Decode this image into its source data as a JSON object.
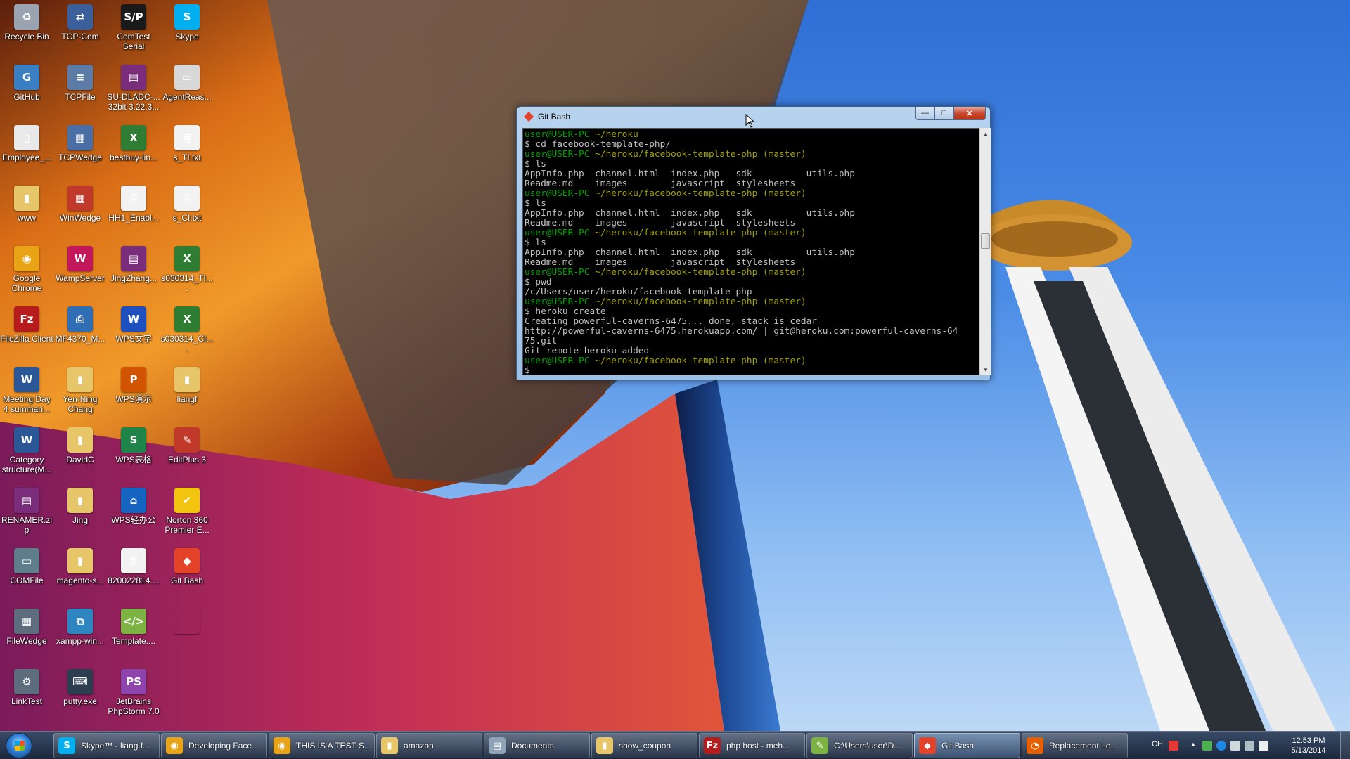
{
  "desktop": {
    "icons": [
      {
        "label": "Recycle Bin",
        "icon": "recycle-bin-icon",
        "color": "#9aa4b0",
        "glyph": "♻"
      },
      {
        "label": "TCP-Com",
        "icon": "tcp-com-icon",
        "color": "#3b5f9a",
        "glyph": "⇄"
      },
      {
        "label": "ComTest Serial",
        "icon": "comtest-serial-icon",
        "color": "#1a1a1a",
        "glyph": "S/P"
      },
      {
        "label": "Skype",
        "icon": "skype-icon",
        "color": "#00aff0",
        "glyph": "S"
      },
      {
        "label": "GitHub",
        "icon": "github-icon",
        "color": "#3a7fc1",
        "glyph": "G"
      },
      {
        "label": "TCPFile",
        "icon": "tcpfile-icon",
        "color": "#5c7ca6",
        "glyph": "≡"
      },
      {
        "label": "SU-DLADC-... 32bit 3.22.3...",
        "icon": "winrar-archive-icon",
        "color": "#7a2d7a",
        "glyph": "▤"
      },
      {
        "label": "AgentReas...",
        "icon": "agentreas-icon",
        "color": "#d8d8d8",
        "glyph": "▭"
      },
      {
        "label": "Employee_...",
        "icon": "document-icon",
        "color": "#e9e9e9",
        "glyph": "▯"
      },
      {
        "label": "TCPWedge",
        "icon": "tcpwedge-icon",
        "color": "#4b6fa5",
        "glyph": "▦"
      },
      {
        "label": "bestbuy-lin...",
        "icon": "excel-file-icon",
        "color": "#2e7d32",
        "glyph": "X"
      },
      {
        "label": "s_TI.txt",
        "icon": "text-file-icon",
        "color": "#f2f2f2",
        "glyph": "≣"
      },
      {
        "label": "www",
        "icon": "folder-icon",
        "color": "#e7c66a",
        "glyph": "▮"
      },
      {
        "label": "WinWedge",
        "icon": "winwedge-icon",
        "color": "#c0392b",
        "glyph": "▦"
      },
      {
        "label": "HH1_Enabl...",
        "icon": "document-icon",
        "color": "#f2f2f2",
        "glyph": "≣"
      },
      {
        "label": "s_CI.txt",
        "icon": "text-file-icon",
        "color": "#f2f2f2",
        "glyph": "≣"
      },
      {
        "label": "Google Chrome",
        "icon": "chrome-icon",
        "color": "#e8a317",
        "glyph": "◉"
      },
      {
        "label": "WampServer",
        "icon": "wampserver-icon",
        "color": "#c2185b",
        "glyph": "W"
      },
      {
        "label": "JingZhang...",
        "icon": "winrar-archive-icon",
        "color": "#7a2d7a",
        "glyph": "▤"
      },
      {
        "label": "s030314_TI....",
        "icon": "excel-file-icon",
        "color": "#2e7d32",
        "glyph": "X"
      },
      {
        "label": "FileZilla Client",
        "icon": "filezilla-icon",
        "color": "#b71c1c",
        "glyph": "Fz"
      },
      {
        "label": "MF4370_M...",
        "icon": "printer-installer-icon",
        "color": "#2f6eb5",
        "glyph": "⎙"
      },
      {
        "label": "WPS文字",
        "icon": "wps-writer-icon",
        "color": "#1e4fbf",
        "glyph": "W"
      },
      {
        "label": "s030314_CI....",
        "icon": "excel-file-icon",
        "color": "#2e7d32",
        "glyph": "X"
      },
      {
        "label": "Meeting Day 4 summari...",
        "icon": "word-file-icon",
        "color": "#2b5797",
        "glyph": "W"
      },
      {
        "label": "Yen-Ning Chang",
        "icon": "folder-icon",
        "color": "#e7c66a",
        "glyph": "▮"
      },
      {
        "label": "WPS演示",
        "icon": "wps-presentation-icon",
        "color": "#d35400",
        "glyph": "P"
      },
      {
        "label": "liangf",
        "icon": "folder-icon",
        "color": "#e7c66a",
        "glyph": "▮"
      },
      {
        "label": "Category structure(M...",
        "icon": "word-file-icon",
        "color": "#2b5797",
        "glyph": "W"
      },
      {
        "label": "DavidC",
        "icon": "folder-icon",
        "color": "#e7c66a",
        "glyph": "▮"
      },
      {
        "label": "WPS表格",
        "icon": "wps-spreadsheet-icon",
        "color": "#1e8449",
        "glyph": "S"
      },
      {
        "label": "EditPlus 3",
        "icon": "editplus-icon",
        "color": "#c0392b",
        "glyph": "✎"
      },
      {
        "label": "RENAMER.zip",
        "icon": "winrar-archive-icon",
        "color": "#7a2d7a",
        "glyph": "▤"
      },
      {
        "label": "Jing",
        "icon": "folder-icon",
        "color": "#e7c66a",
        "glyph": "▮"
      },
      {
        "label": "WPS轻办公",
        "icon": "wps-office-icon",
        "color": "#1565c0",
        "glyph": "⌂"
      },
      {
        "label": "Norton 360 Premier E...",
        "icon": "norton-icon",
        "color": "#f1c40f",
        "glyph": "✔"
      },
      {
        "label": "COMFile",
        "icon": "comfile-icon",
        "color": "#607d8b",
        "glyph": "▭"
      },
      {
        "label": "magento-s...",
        "icon": "folder-icon",
        "color": "#e7c66a",
        "glyph": "▮"
      },
      {
        "label": "820022814....",
        "icon": "document-icon",
        "color": "#f2f2f2",
        "glyph": "≣"
      },
      {
        "label": "Git Bash",
        "icon": "git-bash-icon",
        "color": "#e24329",
        "glyph": "◆"
      },
      {
        "label": "FileWedge",
        "icon": "filewedge-icon",
        "color": "#5d6d7e",
        "glyph": "▦"
      },
      {
        "label": "xampp-win...",
        "icon": "xampp-installer-icon",
        "color": "#2e86c1",
        "glyph": "⧉"
      },
      {
        "label": "Template....",
        "icon": "html-file-icon",
        "color": "#7cb342",
        "glyph": "</>"
      },
      {
        "label": "",
        "icon": "blank-icon",
        "color": "transparent",
        "glyph": ""
      },
      {
        "label": "LinkTest",
        "icon": "linktest-icon",
        "color": "#5d6d7e",
        "glyph": "⚙"
      },
      {
        "label": "putty.exe",
        "icon": "putty-icon",
        "color": "#2c3e50",
        "glyph": "⌨"
      },
      {
        "label": "JetBrains PhpStorm 7.0",
        "icon": "phpstorm-icon",
        "color": "#8e44ad",
        "glyph": "PS"
      }
    ]
  },
  "window": {
    "title": "Git Bash",
    "buttons": {
      "minimize": "—",
      "maximize": "□",
      "close": "✕"
    },
    "terminal": [
      [
        {
          "t": "user@USER-PC",
          "c": "green"
        },
        {
          "t": " ~/heroku",
          "c": "yellow"
        }
      ],
      [
        {
          "t": "$ cd facebook-template-php/",
          "c": "white"
        }
      ],
      [
        {
          "t": "user@USER-PC",
          "c": "green"
        },
        {
          "t": " ~/heroku/facebook-template-php (master)",
          "c": "yellow"
        }
      ],
      [
        {
          "t": "$ ls",
          "c": "white"
        }
      ],
      [
        {
          "t": "AppInfo.php  channel.html  index.php   sdk          utils.php",
          "c": "white"
        }
      ],
      [
        {
          "t": "Readme.md    images        javascript  stylesheets",
          "c": "white"
        }
      ],
      [
        {
          "t": "user@USER-PC",
          "c": "green"
        },
        {
          "t": " ~/heroku/facebook-template-php (master)",
          "c": "yellow"
        }
      ],
      [
        {
          "t": "$ ls",
          "c": "white"
        }
      ],
      [
        {
          "t": "AppInfo.php  channel.html  index.php   sdk          utils.php",
          "c": "white"
        }
      ],
      [
        {
          "t": "Readme.md    images        javascript  stylesheets",
          "c": "white"
        }
      ],
      [
        {
          "t": "user@USER-PC",
          "c": "green"
        },
        {
          "t": " ~/heroku/facebook-template-php (master)",
          "c": "yellow"
        }
      ],
      [
        {
          "t": "$ ls",
          "c": "white"
        }
      ],
      [
        {
          "t": "AppInfo.php  channel.html  index.php   sdk          utils.php",
          "c": "white"
        }
      ],
      [
        {
          "t": "Readme.md    images        javascript  stylesheets",
          "c": "white"
        }
      ],
      [
        {
          "t": "user@USER-PC",
          "c": "green"
        },
        {
          "t": " ~/heroku/facebook-template-php (master)",
          "c": "yellow"
        }
      ],
      [
        {
          "t": "$ pwd",
          "c": "white"
        }
      ],
      [
        {
          "t": "/c/Users/user/heroku/facebook-template-php",
          "c": "white"
        }
      ],
      [
        {
          "t": "user@USER-PC",
          "c": "green"
        },
        {
          "t": " ~/heroku/facebook-template-php (master)",
          "c": "yellow"
        }
      ],
      [
        {
          "t": "$ heroku create",
          "c": "white"
        }
      ],
      [
        {
          "t": "Creating powerful-caverns-6475... done, stack is cedar",
          "c": "white"
        }
      ],
      [
        {
          "t": "http://powerful-caverns-6475.herokuapp.com/ | git@heroku.com:powerful-caverns-64",
          "c": "white"
        }
      ],
      [
        {
          "t": "75.git",
          "c": "white"
        }
      ],
      [
        {
          "t": "Git remote heroku added",
          "c": "white"
        }
      ],
      [
        {
          "t": "user@USER-PC",
          "c": "green"
        },
        {
          "t": " ~/heroku/facebook-template-php (master)",
          "c": "yellow"
        }
      ],
      [
        {
          "t": "$ ",
          "c": "white"
        }
      ]
    ]
  },
  "taskbar": {
    "items": [
      {
        "label": "Skype™ - liang.f...",
        "icon": "skype-icon",
        "color": "#00aff0",
        "glyph": "S",
        "active": false
      },
      {
        "label": "Developing Face...",
        "icon": "chrome-icon",
        "color": "#e8a317",
        "glyph": "◉",
        "active": false
      },
      {
        "label": "THIS IS A TEST S...",
        "icon": "chrome-icon",
        "color": "#e8a317",
        "glyph": "◉",
        "active": false
      },
      {
        "label": "amazon",
        "icon": "folder-icon",
        "color": "#e7c66a",
        "glyph": "▮",
        "active": false
      },
      {
        "label": "Documents",
        "icon": "documents-library-icon",
        "color": "#8fa3b8",
        "glyph": "▤",
        "active": false
      },
      {
        "label": "show_coupon",
        "icon": "folder-icon",
        "color": "#e7c66a",
        "glyph": "▮",
        "active": false
      },
      {
        "label": "php host - meh...",
        "icon": "filezilla-icon",
        "color": "#b71c1c",
        "glyph": "Fz",
        "active": false
      },
      {
        "label": "C:\\Users\\user\\D...",
        "icon": "notepad-icon",
        "color": "#7cb342",
        "glyph": "✎",
        "active": false
      },
      {
        "label": "Git Bash",
        "icon": "git-bash-icon",
        "color": "#e24329",
        "glyph": "◆",
        "active": true
      },
      {
        "label": "Replacement Le...",
        "icon": "firefox-icon",
        "color": "#e66000",
        "glyph": "◔",
        "active": false
      }
    ],
    "tray": {
      "language": "CH",
      "icons": [
        "sogou-ime-icon",
        "show-hidden-icons-chevron-icon",
        "gpu-icon",
        "network-bluetooth-icon",
        "volume-muted-icon",
        "monitor-icon",
        "action-center-flag-icon"
      ],
      "time": "12:53 PM",
      "date": "5/13/2014"
    }
  }
}
